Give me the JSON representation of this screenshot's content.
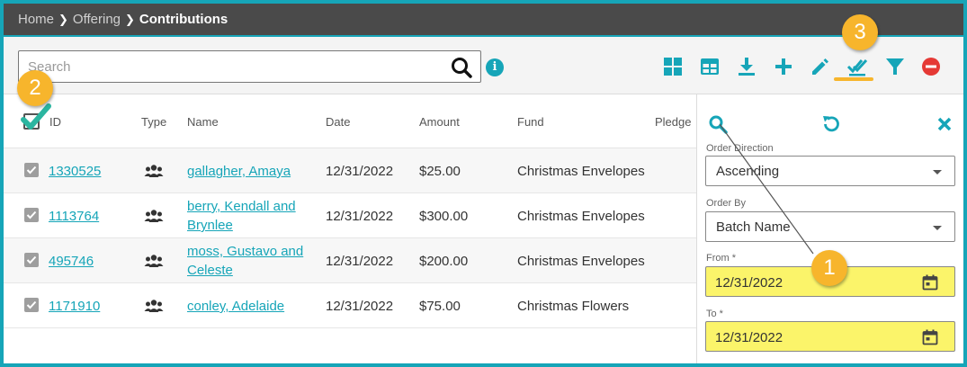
{
  "breadcrumb": {
    "items": [
      "Home",
      "Offering"
    ],
    "separator": "❯",
    "current": "Contributions"
  },
  "search": {
    "placeholder": "Search",
    "value": ""
  },
  "info_icon_glyph": "i",
  "toolbar": {
    "icons": [
      "grid-view-icon",
      "table-view-icon",
      "download-icon",
      "add-icon",
      "edit-icon",
      "multi-select-icon",
      "filter-icon",
      "remove-icon"
    ],
    "accent_color": "#16a5b8",
    "remove_color": "#e53935"
  },
  "grid": {
    "columns": [
      "ID",
      "Type",
      "Name",
      "Date",
      "Amount",
      "Fund",
      "Pledge"
    ],
    "rows": [
      {
        "id": "1330525",
        "name_line1": "gallagher, Amaya",
        "name_line2": "",
        "date": "12/31/2022",
        "amount": "$25.00",
        "fund": "Christmas Envelopes",
        "checked": true
      },
      {
        "id": "1113764",
        "name_line1": "berry, Kendall and",
        "name_line2": "Brynlee",
        "date": "12/31/2022",
        "amount": "$300.00",
        "fund": "Christmas Envelopes",
        "checked": true
      },
      {
        "id": "495746",
        "name_line1": "moss, Gustavo and",
        "name_line2": "Celeste",
        "date": "12/31/2022",
        "amount": "$200.00",
        "fund": "Christmas Envelopes",
        "checked": true
      },
      {
        "id": "1171910",
        "name_line1": "conley, Adelaide",
        "name_line2": "",
        "date": "12/31/2022",
        "amount": "$75.00",
        "fund": "Christmas Flowers",
        "checked": true
      }
    ]
  },
  "side_panel": {
    "order_direction": {
      "label": "Order Direction",
      "value": "Ascending"
    },
    "order_by": {
      "label": "Order By",
      "value": "Batch Name"
    },
    "from": {
      "label": "From *",
      "value": "12/31/2022"
    },
    "to": {
      "label": "To *",
      "value": "12/31/2022"
    }
  },
  "callouts": [
    "1",
    "2",
    "3"
  ],
  "colors": {
    "breadcrumb_bg": "#4a4a4a",
    "frame": "#16a5b8",
    "highlight_field": "#fbf46a",
    "callout": "#f7b52c",
    "checkmark": "#2bb5a0"
  }
}
